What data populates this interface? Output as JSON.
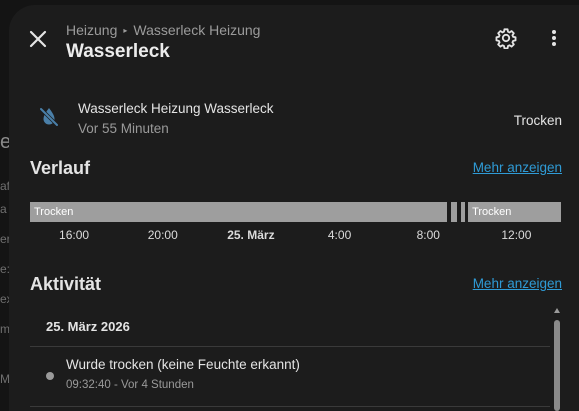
{
  "background": {
    "fragments": [
      "e",
      "af",
      "a",
      "er",
      "e:",
      "ex",
      "m",
      "M"
    ]
  },
  "header": {
    "breadcrumb": [
      "Heizung",
      "Wasserleck Heizung"
    ],
    "title": "Wasserleck"
  },
  "entity": {
    "icon": "water-off-icon",
    "name": "Wasserleck Heizung Wasserleck",
    "last_changed": "Vor 55 Minuten",
    "state": "Trocken"
  },
  "history": {
    "title": "Verlauf",
    "more_label": "Mehr anzeigen",
    "segments": [
      {
        "label": "Trocken",
        "start": 0.0,
        "end": 0.785
      },
      {
        "label": "",
        "start": 0.792,
        "end": 0.805
      },
      {
        "label": "",
        "start": 0.812,
        "end": 0.818
      },
      {
        "label": "Trocken",
        "start": 0.825,
        "end": 1.0
      }
    ],
    "ticks": [
      {
        "label": "16:00",
        "pos": 0.083,
        "bold": false
      },
      {
        "label": "20:00",
        "pos": 0.25,
        "bold": false
      },
      {
        "label": "25. März",
        "pos": 0.416,
        "bold": true
      },
      {
        "label": "4:00",
        "pos": 0.583,
        "bold": false
      },
      {
        "label": "8:00",
        "pos": 0.75,
        "bold": false
      },
      {
        "label": "12:00",
        "pos": 0.916,
        "bold": false
      }
    ]
  },
  "activity": {
    "title": "Aktivität",
    "more_label": "Mehr anzeigen",
    "date": "25. März 2026",
    "entries": [
      {
        "text": "Wurde trocken (keine Feuchte erkannt)",
        "time": "09:32:40 - Vor 4 Stunden"
      }
    ]
  },
  "colors": {
    "timeline": "#9e9e9e",
    "link": "#2f9bd6",
    "icon": "#4a7fa8"
  }
}
